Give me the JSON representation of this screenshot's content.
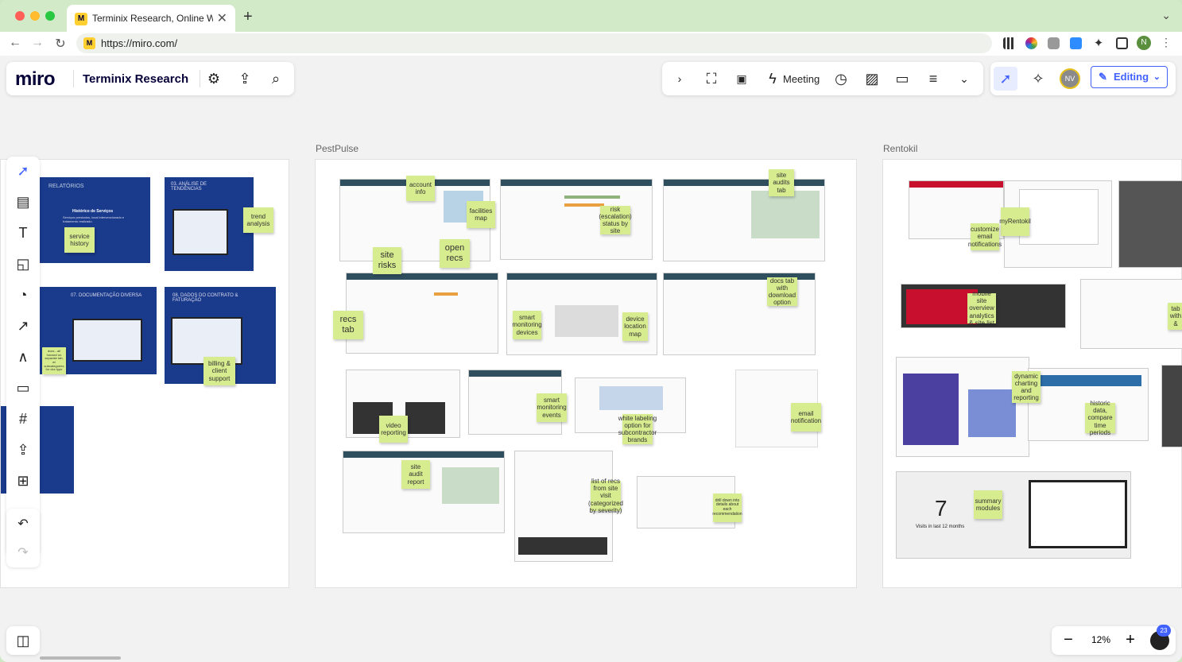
{
  "browser": {
    "tab_title": "Terminix Research, Online Whi",
    "close_symbol": "✕",
    "new_tab_symbol": "+",
    "url": "https://miro.com/",
    "favicon_letter": "M",
    "profile_initial": "N"
  },
  "miro": {
    "logo": "miro",
    "board_name": "Terminix Research",
    "meeting_label": "Meeting",
    "editing_label": "Editing",
    "avatar_initials": "NV",
    "zoom_level": "12%",
    "notification_count": "23"
  },
  "frames": {
    "pestpulse": "PestPulse",
    "rentokil": "Rentokil"
  },
  "left_frame_notes": {
    "service_history": "service history",
    "trend_analysis": "trend analysis",
    "billing_support": "billing & client support",
    "docs_note": "docs - all housed on separate tab, w/ subcategories for doc type"
  },
  "left_frame_slides": {
    "relatorios": "RELATÓRIOS",
    "analise": "03. ANÁLISE DE TENDÊNCIAS",
    "documentacao": "07. DOCUMENTAÇÃO DIVERSA",
    "dados": "08. DADOS DO CONTRATO & FATURAÇÃO",
    "historico": "Histórico de Serviços",
    "historico_sub": "Serviços prestados, local intervencionado e tratamento realizado."
  },
  "pestpulse_notes": {
    "account_info": "account info",
    "facilities_map": "facilities map",
    "site_risks": "site risks",
    "open_recs": "open recs",
    "risk_status": "risk (escalation) status by site",
    "site_audits_tab": "site audits tab",
    "recs_tab": "recs tab",
    "smart_monitoring_devices": "smart monitoring devices",
    "device_location_map": "device location map",
    "docs_tab": "docs tab with download option",
    "video_reporting": "video reporting",
    "smart_monitoring_events": "smart monitoring events",
    "white_labeling": "white labeling option for subcontractor brands",
    "email_notification": "email notification",
    "site_audit_report": "site audit report",
    "list_of_recs": "list of recs from site visit (categorized by severity)",
    "drill_down": "drill down into details about each recommendation"
  },
  "rentokil_notes": {
    "myrentokil": "myRentokil",
    "customize_email": "customize email notifications",
    "mobile_site": "mobile site overview analytics & site list",
    "tab_with": "tab with &",
    "dynamic_charting": "dynamic charting and reporting",
    "historic_data": "historic data, compare time periods",
    "summary_modules": "summary modules",
    "big_number": "7",
    "visits_label": "Visits in last 12 months"
  }
}
